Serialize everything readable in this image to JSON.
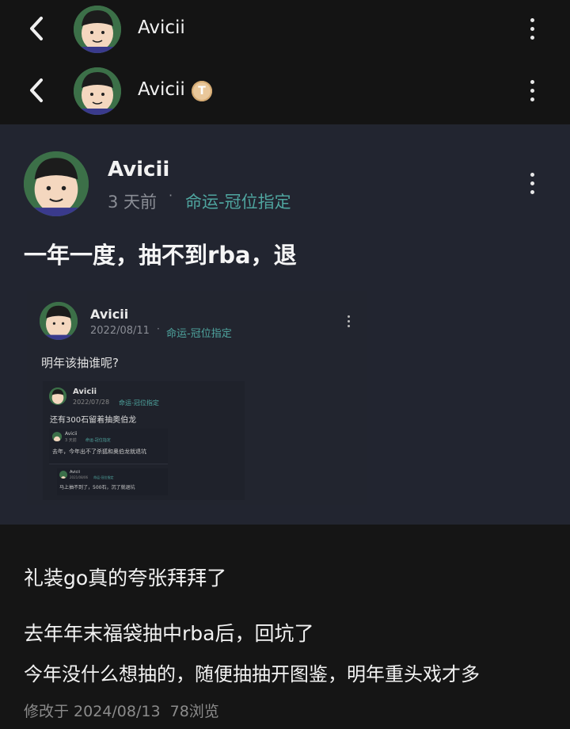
{
  "header": {
    "back_icon": "chevron-left-icon",
    "name": "Avicii",
    "badge": "T",
    "more_icon": "more-vertical-icon"
  },
  "post": {
    "author": "Avicii",
    "time": "3 天前",
    "dot": "·",
    "topic": "命运-冠位指定",
    "title": "一年一度，抽不到rba，退"
  },
  "quote1": {
    "author": "Avicii",
    "date": "2022/08/11",
    "dot": "·",
    "topic": "命运-冠位指定",
    "text": "明年该抽谁呢?"
  },
  "quote2": {
    "author": "Avicii",
    "date": "2022/07/28",
    "topic": "命运-冠位指定",
    "text": "还有300石留着抽奥伯龙"
  },
  "quote3": {
    "author": "Avicii",
    "date": "3 天前",
    "topic": "命运-冠位指定",
    "text": "去年，今年出不了杀狐和奥伯龙就退坑"
  },
  "quote4": {
    "author": "Avicii",
    "date": "2021/08/06",
    "topic": "命运-冠位指定",
    "text": "马上抽不到了，500石，沉了就退坑"
  },
  "body": {
    "line1": "礼装go真的夸张拜拜了",
    "line2": "去年年末福袋抽中rba后，回坑了",
    "line3": "今年没什么想抽的，随便抽抽开图鉴，明年重头戏才多",
    "footer": "修改于 2024/08/13  78浏览"
  },
  "colors": {
    "background": "#151515",
    "post_background": "#222530",
    "topic_color": "#4fa59f",
    "meta_color": "#8a8d95"
  }
}
